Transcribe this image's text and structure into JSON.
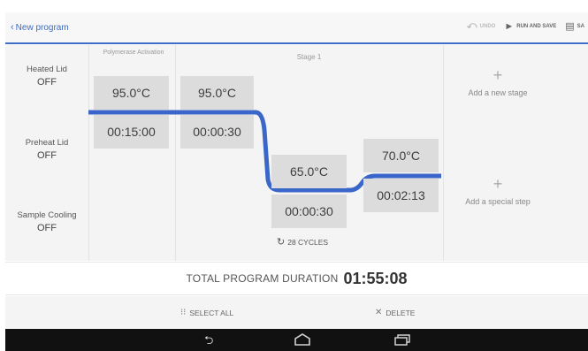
{
  "header": {
    "back_label": "New program",
    "undo_label": "UNDO",
    "run_save_label": "RUN AND SAVE",
    "save_label": "SA"
  },
  "side_settings": [
    {
      "label": "Heated Lid",
      "value": "OFF"
    },
    {
      "label": "Preheat Lid",
      "value": "OFF"
    },
    {
      "label": "Sample Cooling",
      "value": "OFF"
    }
  ],
  "stages": {
    "initial": {
      "title": "Polymerase Activation",
      "step": {
        "temperature": "95.0°C",
        "duration": "00:15:00"
      }
    },
    "stage1": {
      "title": "Stage 1",
      "steps": [
        {
          "temperature": "95.0°C",
          "duration": "00:00:30"
        },
        {
          "temperature": "65.0°C",
          "duration": "00:00:30"
        },
        {
          "temperature": "70.0°C",
          "duration": "00:02:13"
        }
      ],
      "cycles_label": "28 CYCLES"
    }
  },
  "add_options": {
    "new_stage": "Add a new stage",
    "special_step": "Add a special step"
  },
  "total": {
    "label": "TOTAL PROGRAM DURATION",
    "value": "01:55:08"
  },
  "actions": {
    "select_all": "SELECT ALL",
    "delete": "DELETE"
  },
  "colors": {
    "accent": "#3e6fc6",
    "curve": "#3b66c9"
  }
}
